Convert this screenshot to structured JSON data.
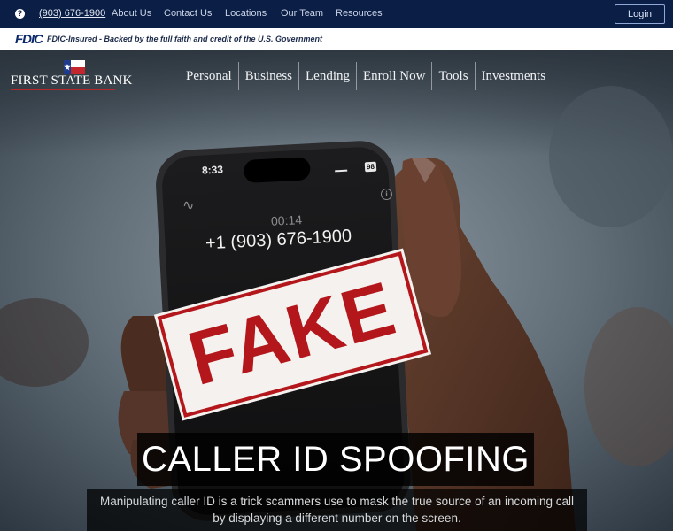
{
  "topbar": {
    "help_icon": "question-circle-icon",
    "phone": "(903) 676-1900",
    "links": [
      "About Us",
      "Contact Us",
      "Locations",
      "Our Team",
      "Resources"
    ],
    "login_label": "Login"
  },
  "fdic": {
    "logo": "FDIC",
    "text": "FDIC-Insured - Backed by the full faith and credit of the U.S. Government"
  },
  "brand": {
    "name": "FIRST STATE BANK",
    "icon": "texas-flag-icon"
  },
  "nav": {
    "items": [
      "Personal",
      "Business",
      "Lending",
      "Enroll Now",
      "Tools",
      "Investments"
    ]
  },
  "hero": {
    "phone_time": "8:33",
    "battery": "98",
    "call_timer": "00:14",
    "call_number": "+1 (903) 676-1900",
    "stamp": "FAKE",
    "title": "CALLER ID SPOOFING",
    "description": "Manipulating caller ID is a trick scammers use to mask the true source of an incoming call by displaying a different number on the screen."
  },
  "colors": {
    "topbar_bg": "#0a1e46",
    "stamp_red": "#b3161b",
    "brand_red": "#b8262a"
  }
}
